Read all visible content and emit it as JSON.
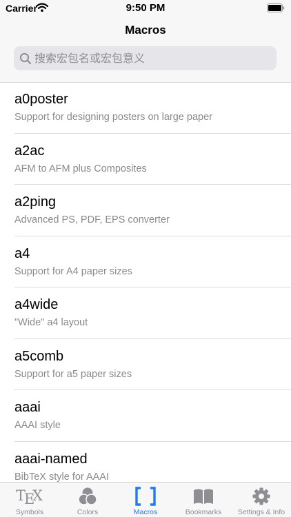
{
  "status_bar": {
    "carrier": "Carrier",
    "time": "9:50 PM"
  },
  "nav": {
    "title": "Macros"
  },
  "search": {
    "placeholder": "搜索宏包名或宏包意义"
  },
  "macros": [
    {
      "name": "a0poster",
      "description": "Support for designing posters on large paper"
    },
    {
      "name": "a2ac",
      "description": "AFM to AFM plus Composites"
    },
    {
      "name": "a2ping",
      "description": "Advanced PS, PDF, EPS converter"
    },
    {
      "name": "a4",
      "description": "Support for A4 paper sizes"
    },
    {
      "name": "a4wide",
      "description": "\"Wide\" a4 layout"
    },
    {
      "name": "a5comb",
      "description": "Support for a5 paper sizes"
    },
    {
      "name": "aaai",
      "description": "AAAI style"
    },
    {
      "name": "aaai-named",
      "description": "BibTeX style for AAAI"
    }
  ],
  "tabs": [
    {
      "label": "Symbols",
      "icon": "tex-logo-icon",
      "active": false
    },
    {
      "label": "Colors",
      "icon": "colors-icon",
      "active": false
    },
    {
      "label": "Macros",
      "icon": "brackets-icon",
      "active": true
    },
    {
      "label": "Bookmarks",
      "icon": "book-icon",
      "active": false
    },
    {
      "label": "Settings & Info",
      "icon": "gear-icon",
      "active": false
    }
  ],
  "colors": {
    "accent": "#1a7cf5",
    "inactive": "#8e8e93",
    "secondary_text": "#8a8a8e"
  },
  "tex_logo": {
    "t": "T",
    "e": "E",
    "x": "X"
  }
}
